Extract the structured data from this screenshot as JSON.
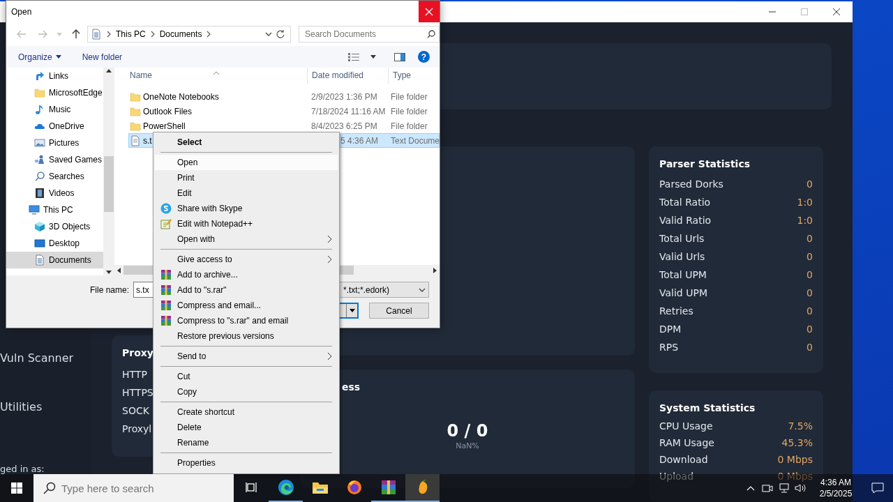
{
  "app_window": {
    "sidebar": [
      {
        "label": "Vuln Scanner"
      },
      {
        "label": "Utilities"
      }
    ],
    "login_label": "ged in as:",
    "proxy_card": {
      "title": "Proxy",
      "rows": [
        "HTTP",
        "HTTPS",
        "SOCK",
        "Proxyl"
      ]
    },
    "progress_card": {
      "title": "ess",
      "count": "0 / 0",
      "percent": "NaN%"
    },
    "parser_statistics": {
      "title": "Parser Statistics",
      "rows": [
        {
          "label": "Parsed Dorks",
          "value": "0"
        },
        {
          "label": "Total Ratio",
          "value": "1:0"
        },
        {
          "label": "Valid Ratio",
          "value": "1:0"
        },
        {
          "label": "Total Urls",
          "value": "0"
        },
        {
          "label": "Valid Urls",
          "value": "0"
        },
        {
          "label": "Total UPM",
          "value": "0"
        },
        {
          "label": "Valid UPM",
          "value": "0"
        },
        {
          "label": "Retries",
          "value": "0"
        },
        {
          "label": "DPM",
          "value": "0"
        },
        {
          "label": "RPS",
          "value": "0"
        }
      ]
    },
    "system_statistics": {
      "title": "System Statistics",
      "rows": [
        {
          "label": "CPU Usage",
          "value": "7.5%"
        },
        {
          "label": "RAM Usage",
          "value": "45.3%"
        },
        {
          "label": "Download",
          "value": "0 Mbps"
        },
        {
          "label": "Upload",
          "value": "0 Mbps"
        }
      ]
    }
  },
  "open_dialog": {
    "title": "Open",
    "address": [
      "This PC",
      "Documents"
    ],
    "search": {
      "placeholder": "Search Documents"
    },
    "toolbar": {
      "organize": "Organize",
      "new_folder": "New folder",
      "help": "?"
    },
    "nav_pane": [
      {
        "label": "Links",
        "kind": "link",
        "selected": false
      },
      {
        "label": "MicrosoftEdge",
        "kind": "folder",
        "selected": false
      },
      {
        "label": "Music",
        "kind": "music",
        "selected": false
      },
      {
        "label": "OneDrive",
        "kind": "cloud",
        "selected": false
      },
      {
        "label": "Pictures",
        "kind": "pictures",
        "selected": false
      },
      {
        "label": "Saved Games",
        "kind": "games",
        "selected": false
      },
      {
        "label": "Searches",
        "kind": "search",
        "selected": false
      },
      {
        "label": "Videos",
        "kind": "video",
        "selected": false
      },
      {
        "label": "This PC",
        "kind": "computer",
        "selected": false,
        "children": [
          {
            "label": "3D Objects",
            "kind": "cube",
            "selected": false
          },
          {
            "label": "Desktop",
            "kind": "desktop",
            "selected": false
          },
          {
            "label": "Documents",
            "kind": "document",
            "selected": true
          }
        ]
      }
    ],
    "columns": [
      "Name",
      "Date modified",
      "Type"
    ],
    "files": [
      {
        "name": "OneNote Notebooks",
        "date": "2/9/2023 1:36 PM",
        "type": "File folder",
        "kind": "folder",
        "selected": false
      },
      {
        "name": "Outlook Files",
        "date": "7/18/2024 11:16 AM",
        "type": "File folder",
        "kind": "folder",
        "selected": false
      },
      {
        "name": "PowerShell",
        "date": "8/4/2023 6:25 PM",
        "type": "File folder",
        "kind": "folder",
        "selected": false
      },
      {
        "name": "s.t",
        "date": "5 4:36 AM",
        "type": "Text Docume",
        "kind": "text",
        "selected": true
      }
    ],
    "file_name": {
      "label": "File name:",
      "value": "s.tx"
    },
    "filter": "*.txt;*.edork)",
    "cancel": "Cancel"
  },
  "context_menu": {
    "items": [
      {
        "kind": "header",
        "label": "Select",
        "selected": false
      },
      {
        "kind": "separator"
      },
      {
        "kind": "item",
        "label": "Open",
        "selected": true
      },
      {
        "kind": "item",
        "label": "Print",
        "selected": false
      },
      {
        "kind": "item",
        "label": "Edit",
        "selected": false
      },
      {
        "kind": "skype",
        "label": "Share with Skype",
        "selected": false
      },
      {
        "kind": "notepad",
        "label": "Edit with Notepad++",
        "selected": false
      },
      {
        "kind": "submenu",
        "label": "Open with",
        "selected": false
      },
      {
        "kind": "separator"
      },
      {
        "kind": "submenu",
        "label": "Give access to",
        "selected": false
      },
      {
        "kind": "archive",
        "label": "Add to archive...",
        "selected": false
      },
      {
        "kind": "archive",
        "label": "Add to \"s.rar\"",
        "selected": false
      },
      {
        "kind": "archive",
        "label": "Compress and email...",
        "selected": false
      },
      {
        "kind": "archive",
        "label": "Compress to \"s.rar\" and email",
        "selected": false
      },
      {
        "kind": "item",
        "label": "Restore previous versions",
        "selected": false
      },
      {
        "kind": "separator"
      },
      {
        "kind": "submenu",
        "label": "Send to",
        "selected": false
      },
      {
        "kind": "separator"
      },
      {
        "kind": "item",
        "label": "Cut",
        "selected": false
      },
      {
        "kind": "item",
        "label": "Copy",
        "selected": false
      },
      {
        "kind": "separator"
      },
      {
        "kind": "item",
        "label": "Create shortcut",
        "selected": false
      },
      {
        "kind": "item",
        "label": "Delete",
        "selected": false
      },
      {
        "kind": "item",
        "label": "Rename",
        "selected": false
      },
      {
        "kind": "separator"
      },
      {
        "kind": "item",
        "label": "Properties",
        "selected": false
      }
    ]
  },
  "taskbar": {
    "search": {
      "placeholder": "Type here to search"
    },
    "apps": [
      {
        "kind": "taskview",
        "running": false,
        "selected": false
      },
      {
        "kind": "edge",
        "running": true,
        "selected": false
      },
      {
        "kind": "explorer",
        "running": false,
        "selected": false
      },
      {
        "kind": "firefox",
        "running": false,
        "selected": false
      },
      {
        "kind": "winrar",
        "running": true,
        "selected": false
      },
      {
        "kind": "mango",
        "running": true,
        "selected": true
      }
    ],
    "time": "4:36 AM",
    "date": "2/5/2025"
  }
}
